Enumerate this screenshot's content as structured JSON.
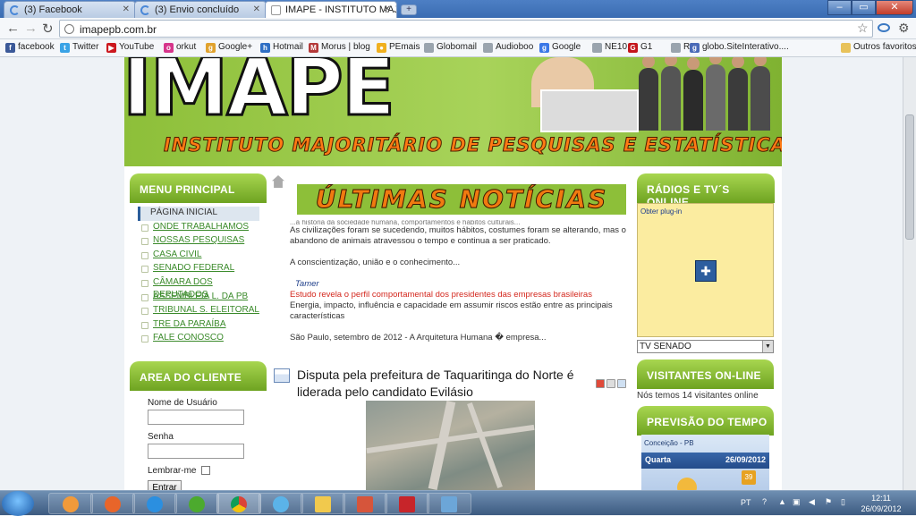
{
  "browser": {
    "tabs": [
      {
        "label": "(3) Facebook",
        "active": false
      },
      {
        "label": "(3) Envio concluído",
        "active": false
      },
      {
        "label": "IMAPE - INSTITUTO MAJ...",
        "active": true
      }
    ],
    "new_tab_label": "+",
    "url": "imapepb.com.br",
    "window_controls": {
      "minimize": "–",
      "maximize": "▭",
      "close": "✕"
    }
  },
  "bookmarks": [
    {
      "label": "facebook",
      "icon": "facebook-icon",
      "color": "#3b5998",
      "glyph": "f"
    },
    {
      "label": "Twitter",
      "icon": "twitter-icon",
      "color": "#3aa3e6",
      "glyph": "t"
    },
    {
      "label": "YouTube",
      "icon": "youtube-icon",
      "color": "#cc181e",
      "glyph": "▶"
    },
    {
      "label": "orkut",
      "icon": "orkut-icon",
      "color": "#d6358b",
      "glyph": "o"
    },
    {
      "label": "Google+",
      "icon": "google-plus-icon",
      "color": "#e0a22e",
      "glyph": "g"
    },
    {
      "label": "Hotmail",
      "icon": "hotmail-icon",
      "color": "#2f6fc4",
      "glyph": "h"
    },
    {
      "label": "Morus | blog",
      "icon": "morus-icon",
      "color": "#b43a3a",
      "glyph": "M"
    },
    {
      "label": "PEmais",
      "icon": "pemais-icon",
      "color": "#f0b020",
      "glyph": "●"
    },
    {
      "label": "Globomail",
      "icon": "page-icon",
      "color": "#9aa4ae",
      "glyph": ""
    },
    {
      "label": "Audioboo",
      "icon": "page-icon",
      "color": "#9aa4ae",
      "glyph": ""
    },
    {
      "label": "Google",
      "icon": "google-icon",
      "color": "#3b78e7",
      "glyph": "g"
    },
    {
      "label": "NE10",
      "icon": "page-icon",
      "color": "#9aa4ae",
      "glyph": ""
    },
    {
      "label": "G1",
      "icon": "g1-icon",
      "color": "#c4161c",
      "glyph": "G"
    },
    {
      "label": "R7",
      "icon": "page-icon",
      "color": "#9aa4ae",
      "glyph": ""
    },
    {
      "label": "globo.SiteInterativo....",
      "icon": "globo-icon",
      "color": "#4a6ab8",
      "glyph": "g"
    }
  ],
  "other_bookmarks": "Outros favoritos",
  "banner": {
    "logo": "IMAPE",
    "subtitle": "INSTITUTO MAJORITÁRIO DE PESQUISAS E ESTATÍSTICAS"
  },
  "menu": {
    "title": "MENU PRINCIPAL",
    "items": [
      {
        "label": "PÁGINA INICIAL",
        "current": true
      },
      {
        "label": "ONDE TRABALHAMOS"
      },
      {
        "label": "NOSSAS PESQUISAS"
      },
      {
        "label": "CASA CIVIL"
      },
      {
        "label": "SENADO FEDERAL"
      },
      {
        "label": "CÂMARA DOS DEPUTADOS"
      },
      {
        "label": "ASSEMBLEIA L. DA PB"
      },
      {
        "label": "TRIBUNAL S. ELEITORAL"
      },
      {
        "label": "TRE DA PARAÍBA"
      },
      {
        "label": "FALE CONOSCO"
      }
    ]
  },
  "client_area": {
    "title": "AREA DO CLIENTE",
    "username_label": "Nome de Usuário",
    "password_label": "Senha",
    "remember_label": "Lembrar-me",
    "submit_label": "Entrar"
  },
  "news": {
    "header": "ÚLTIMAS NOTÍCIAS",
    "clipped_line": "...a história da sociedade humana, comportamentos e hábitos culturais...",
    "paragraph1": "As civilizações foram se sucedendo, muitos hábitos, costumes foram se alterando, mas o abandono de animais atravessou o tempo e continua a ser praticado.",
    "paragraph2": "A conscientização, união e o conhecimento...",
    "author": "Tamer",
    "headline": "Estudo revela o perfil comportamental dos presidentes das empresas brasileiras",
    "paragraph3": "Energia, impacto, influência e capacidade em assumir riscos estão entre as principais características",
    "paragraph4": "São Paulo, setembro de 2012 - A Arquitetura Humana � empresa..."
  },
  "article": {
    "title": "Disputa pela prefeitura de Taquaritinga do Norte é liderada pelo candidato Evilásio"
  },
  "radio": {
    "title": "RÁDIOS E TV´S ONLINE",
    "plugin_text": "Obter plug-in",
    "selected_channel": "TV SENADO"
  },
  "visitors": {
    "title": "VISITANTES ON-LINE",
    "text": "Nós temos 14 visitantes online"
  },
  "weather": {
    "title": "PREVISÃO DO TEMPO",
    "city": "Conceição - PB",
    "day": "Quarta",
    "date": "26/09/2012",
    "temp": "39"
  },
  "taskbar": {
    "language": "PT",
    "time": "12:11",
    "date": "26/09/2012"
  }
}
